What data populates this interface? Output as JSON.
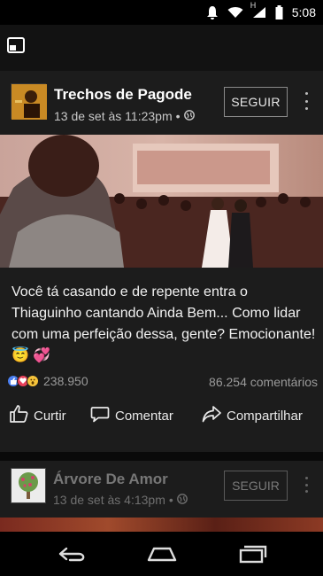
{
  "status_bar": {
    "time": "5:08",
    "network_label": "H",
    "icons": [
      "alarm-icon",
      "wifi-icon",
      "signal-icon",
      "battery-icon"
    ]
  },
  "top_bar": {
    "icons": [
      "picture-in-picture-icon"
    ]
  },
  "post1": {
    "page_name": "Trechos de Pagode",
    "timestamp": "13 de set às 11:23pm",
    "separator": "•",
    "follow_label": "SEGUIR",
    "caption": "Você tá casando e de repente entra o Thiaguinho cantando Ainda Bem... Como lidar com uma perfeição dessa, gente? Emocionante! 😇 💞",
    "reaction_count": "238.950",
    "comment_count": "86.254 comentários",
    "actions": {
      "like": "Curtir",
      "comment": "Comentar",
      "share": "Compartilhar"
    }
  },
  "post2": {
    "page_name": "Árvore De Amor",
    "timestamp": "13 de set às 4:13pm",
    "separator": "•",
    "follow_label": "SEGUIR"
  },
  "colors": {
    "background": "#1c1c1c",
    "like_blue": "#4b7ff0",
    "love_red": "#e8405a",
    "wow_yellow": "#f5c33b"
  }
}
